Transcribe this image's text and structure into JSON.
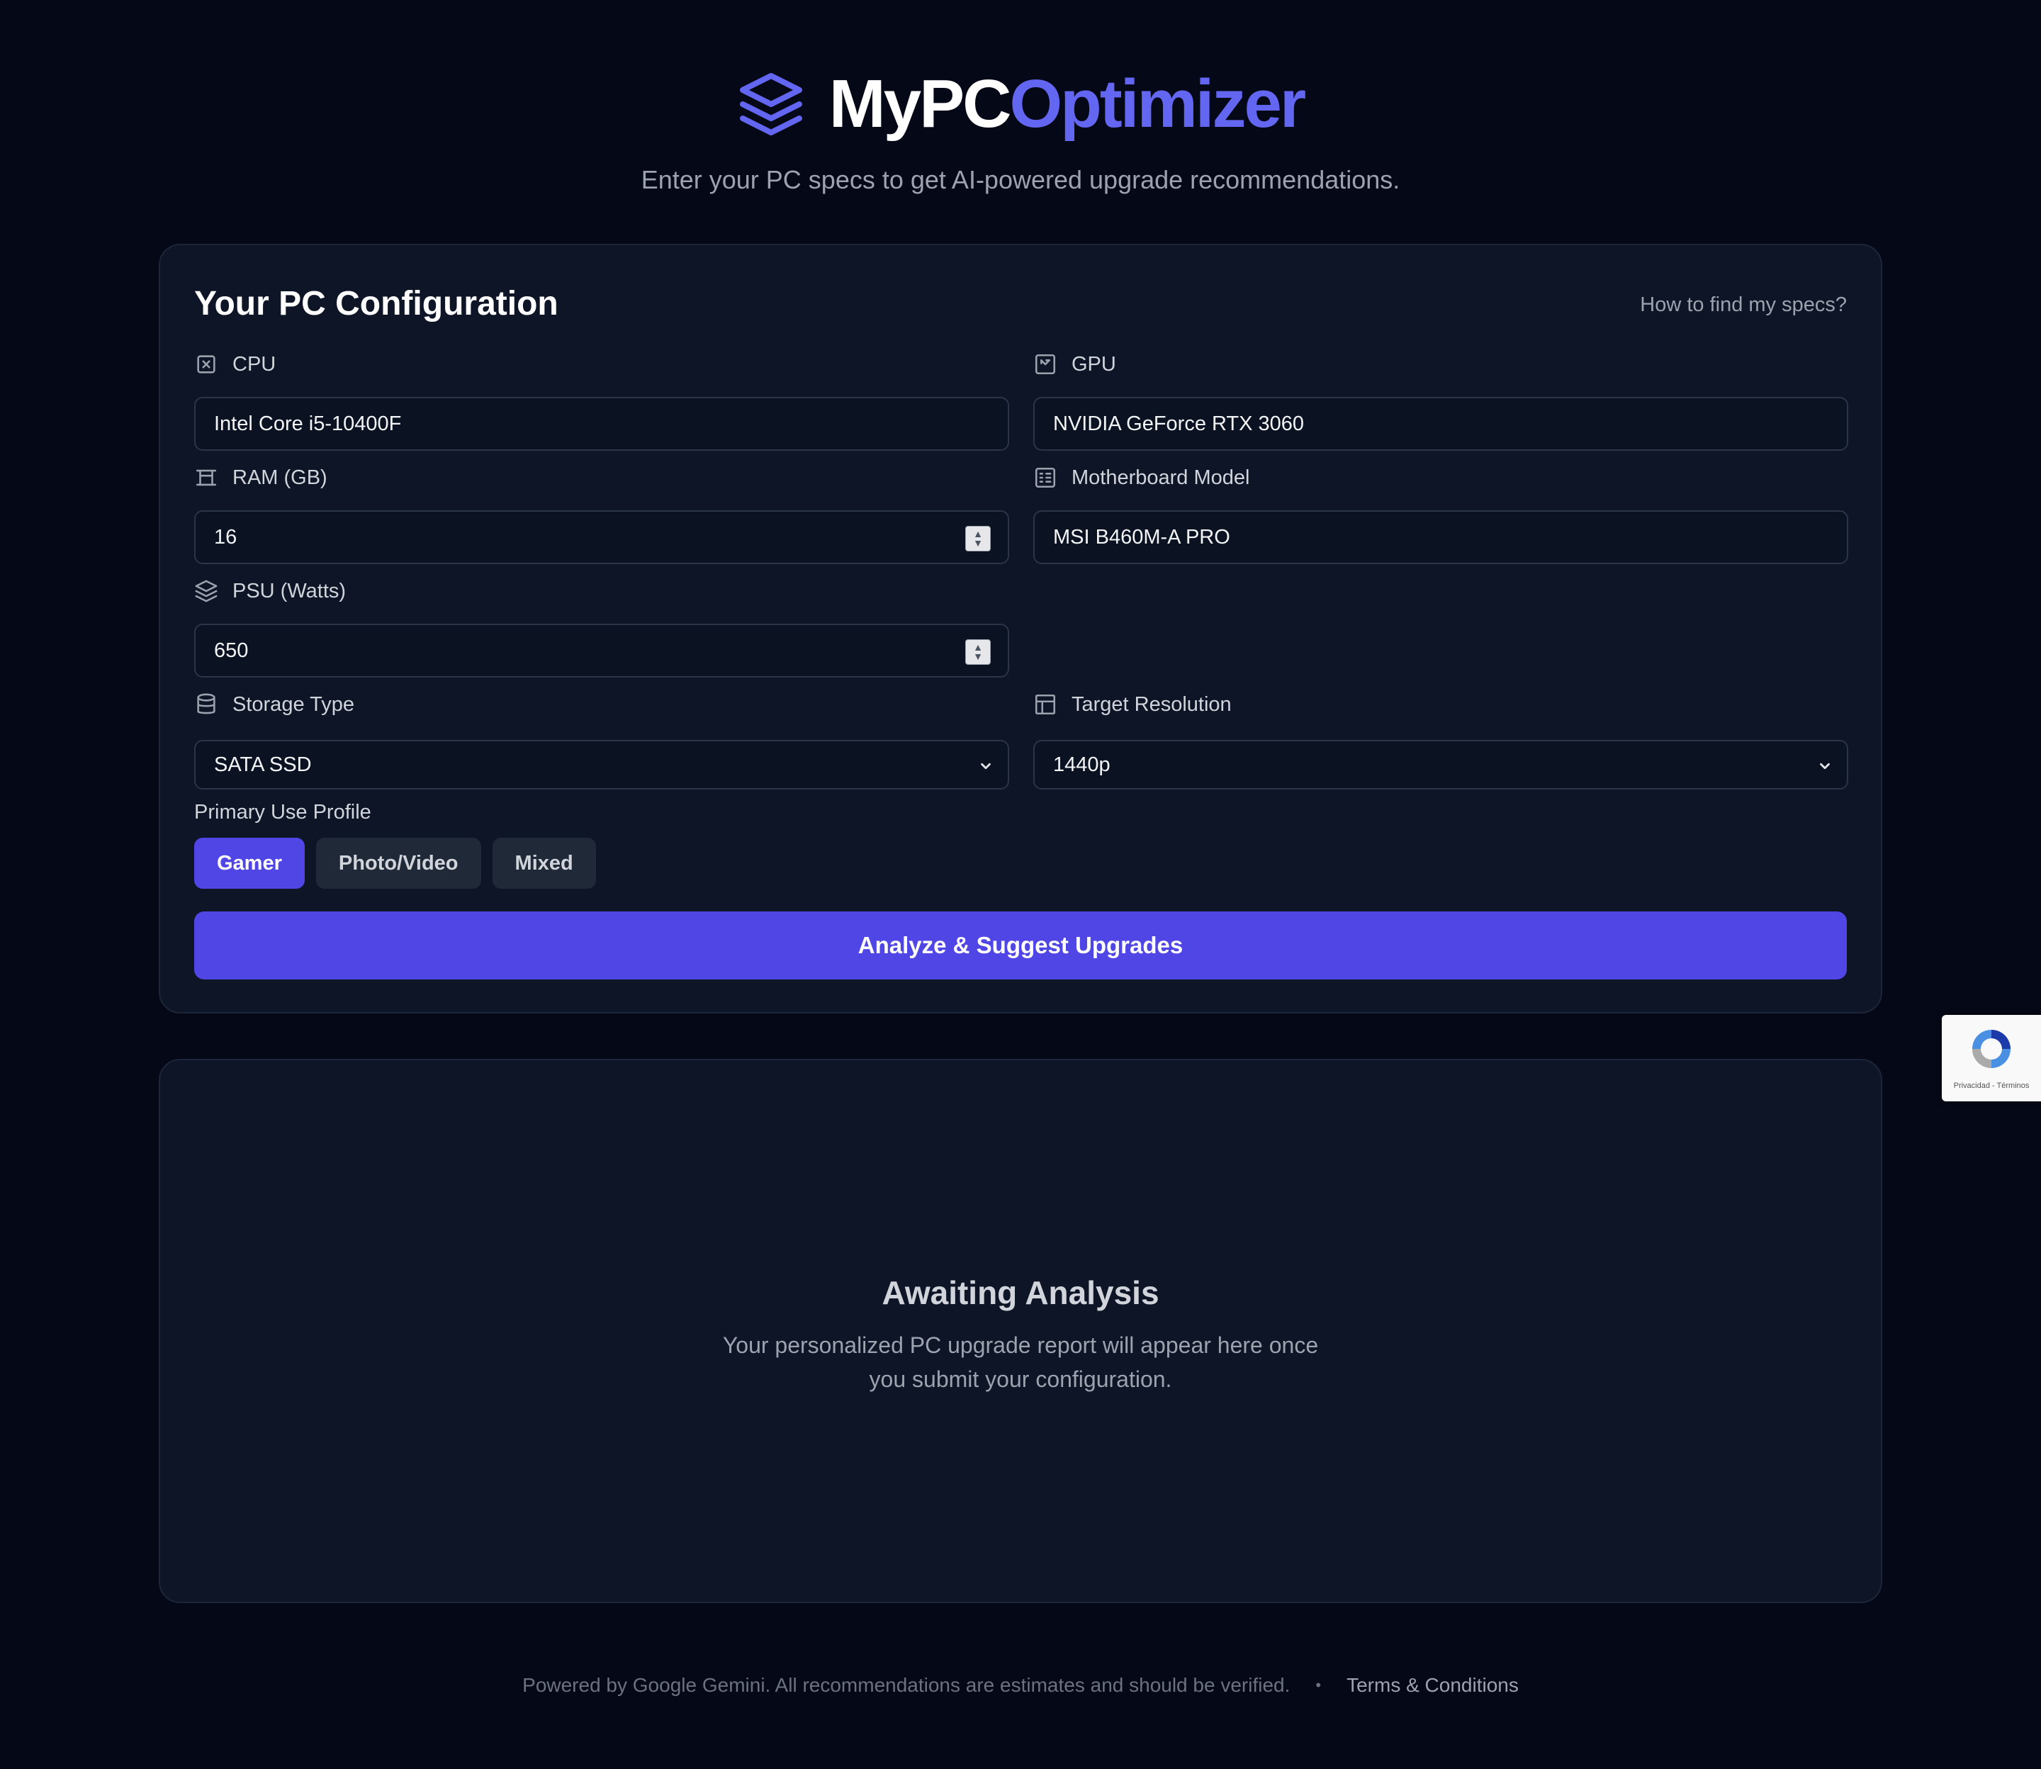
{
  "brand": {
    "title_part1": "MyPC",
    "title_part2": "Optimizer",
    "subtitle": "Enter your PC specs to get AI-powered upgrade recommendations.",
    "accent_color": "#6366f1"
  },
  "config": {
    "title": "Your PC Configuration",
    "help_link": "How to find my specs?",
    "fields": {
      "cpu": {
        "label": "CPU",
        "value": "Intel Core i5-10400F",
        "icon": "cpu-icon"
      },
      "gpu": {
        "label": "GPU",
        "value": "NVIDIA GeForce RTX 3060",
        "icon": "gpu-icon"
      },
      "ram": {
        "label": "RAM (GB)",
        "value": "16",
        "icon": "ram-icon"
      },
      "motherboard": {
        "label": "Motherboard Model",
        "value": "MSI B460M-A PRO",
        "icon": "motherboard-icon"
      },
      "psu": {
        "label": "PSU (Watts)",
        "value": "650",
        "icon": "psu-layers-icon"
      },
      "storage": {
        "label": "Storage Type",
        "value": "SATA SSD",
        "icon": "database-icon"
      },
      "resolution": {
        "label": "Target Resolution",
        "value": "1440p",
        "icon": "layout-grid-icon"
      }
    },
    "profile": {
      "label": "Primary Use Profile",
      "options": [
        "Gamer",
        "Photo/Video",
        "Mixed"
      ],
      "selected": "Gamer"
    },
    "submit_label": "Analyze & Suggest Upgrades"
  },
  "results": {
    "title": "Awaiting Analysis",
    "text": "Your personalized PC upgrade report will appear here once you submit your configuration."
  },
  "footer": {
    "text": "Powered by Google Gemini. All recommendations are estimates and should be verified.",
    "separator": "•",
    "terms": "Terms & Conditions"
  },
  "recaptcha": {
    "text": "Privacidad - Términos"
  },
  "colors": {
    "background": "#050816",
    "card": "#0d1526",
    "primary_button": "#4f46e5"
  }
}
